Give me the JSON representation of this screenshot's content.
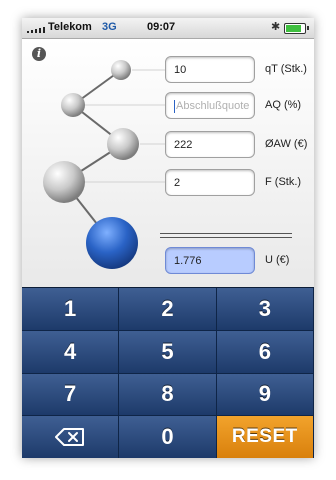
{
  "status_bar": {
    "carrier": "Telekom",
    "network": "3G",
    "time": "09:07",
    "bluetooth_icon": "bluetooth-icon",
    "battery_icon": "battery-icon",
    "battery_level": 0.85
  },
  "info_button": {
    "label": "i",
    "icon": "info-icon"
  },
  "fields": [
    {
      "value": "10",
      "placeholder": "",
      "unit": "qT (Stk.)"
    },
    {
      "value": "",
      "placeholder": "Abschlußquote",
      "unit": "AQ (%)"
    },
    {
      "value": "222",
      "placeholder": "",
      "unit": "ØAW (€)"
    },
    {
      "value": "2",
      "placeholder": "",
      "unit": "F (Stk.)"
    }
  ],
  "result": {
    "value": "1.776",
    "unit": "U (€)"
  },
  "keypad": {
    "keys": [
      "1",
      "2",
      "3",
      "4",
      "5",
      "6",
      "7",
      "8",
      "9",
      "",
      "0",
      "RESET"
    ],
    "backspace_icon": "backspace-icon"
  },
  "colors": {
    "keypad": "#1d3a6a",
    "reset": "#e8900f",
    "result_field": "#b8ccff",
    "result_sphere": "#2a63c6"
  }
}
